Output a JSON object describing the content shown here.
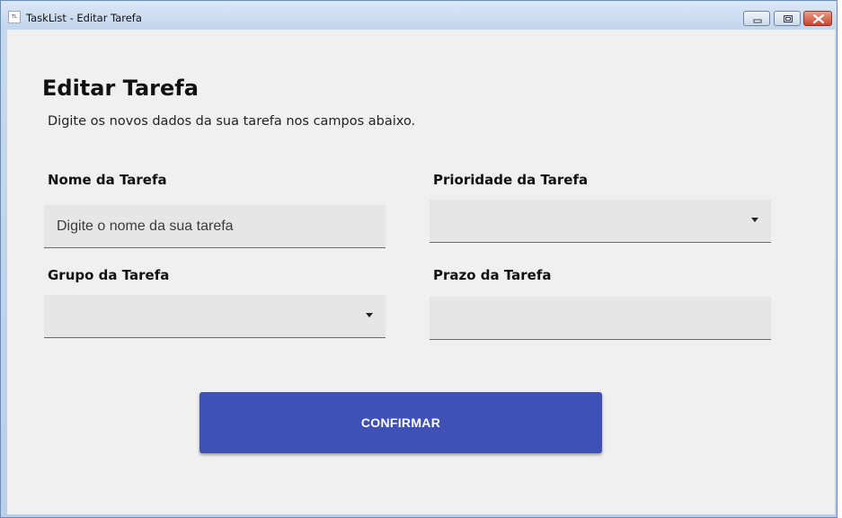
{
  "window": {
    "title": "TaskList - Editar Tarefa",
    "icon": "tasklist-app-icon",
    "icon_text": "TL",
    "controls": [
      "minimize-icon",
      "maximize-icon",
      "close-icon"
    ]
  },
  "form": {
    "title": "Editar Tarefa",
    "subtitle": "Digite os novos dados da sua tarefa nos campos abaixo.",
    "fields": {
      "nome": {
        "label": "Nome da Tarefa",
        "value": "",
        "placeholder": "Digite o nome da sua tarefa"
      },
      "prioridade": {
        "label": "Prioridade da Tarefa",
        "selected": ""
      },
      "grupo": {
        "label": "Grupo da Tarefa",
        "selected": ""
      },
      "prazo": {
        "label": "Prazo da Tarefa",
        "value": ""
      }
    },
    "confirm_label": "CONFIRMAR"
  },
  "colors": {
    "accent": "#3f51b5",
    "background": "#f0f0f0",
    "field_background": "#e6e6e6",
    "titlebar": "#c9dbf0"
  }
}
